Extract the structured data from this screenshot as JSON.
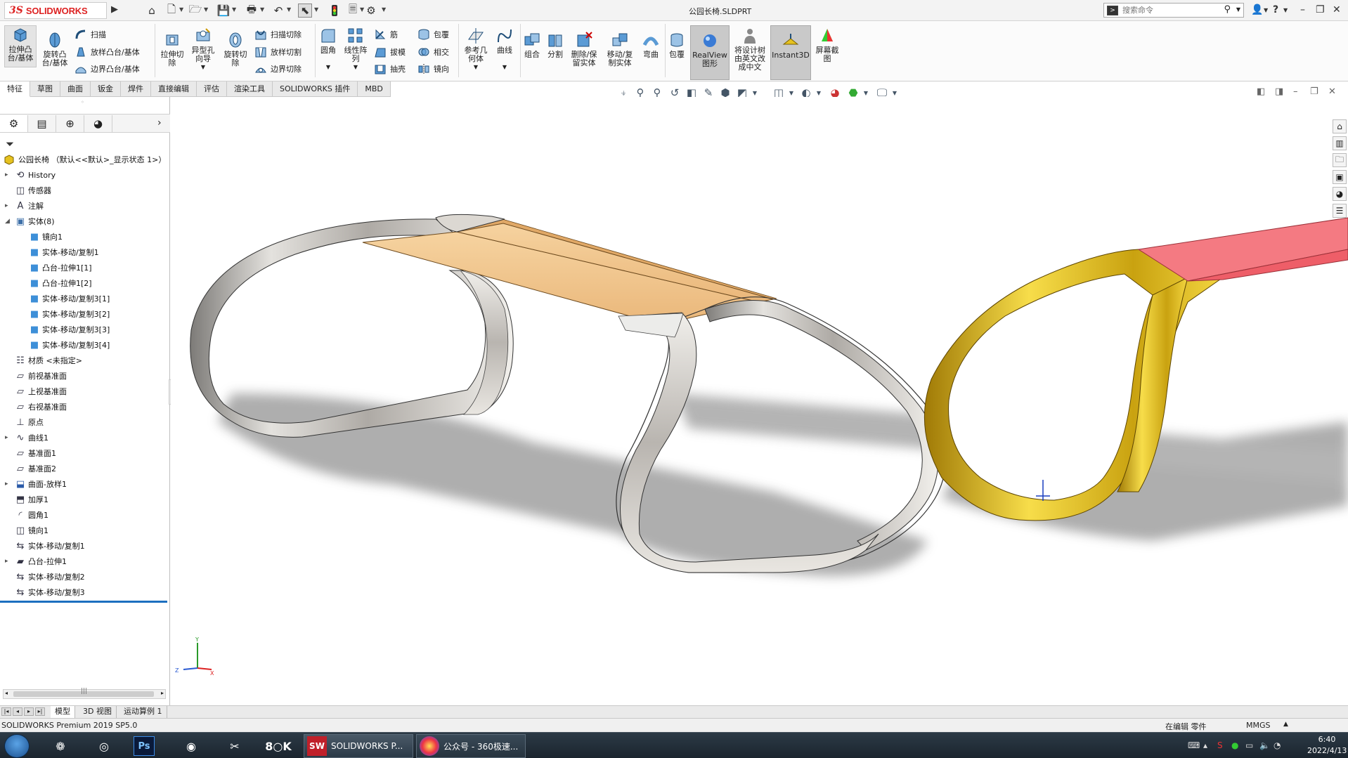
{
  "titlebar": {
    "brand_prefix": "3S",
    "brand": "SOLIDWORKS",
    "document_title": "公园长椅.SLDPRT",
    "search_placeholder": "搜索命令",
    "quick_access_icons": [
      "home-icon",
      "new-file-icon",
      "open-icon",
      "save-icon",
      "print-icon",
      "undo-icon",
      "select-icon",
      "rebuild-icon",
      "file-properties-icon",
      "options-icon"
    ]
  },
  "ribbon": {
    "extrude_boss": "拉伸凸台/基体",
    "revolve_boss": "旋转凸台/基体",
    "sweep": "扫描",
    "loft_boss": "放样凸台/基体",
    "boundary_boss": "边界凸台/基体",
    "extrude_cut": "拉伸切除",
    "hole_wizard": "异型孔向导",
    "revolve_cut": "旋转切除",
    "sweep_cut": "扫描切除",
    "loft_cut": "放样切割",
    "boundary_cut": "边界切除",
    "fillet": "圆角",
    "linear_pattern": "线性阵列",
    "rib": "筋",
    "draft": "拔模",
    "shell": "抽壳",
    "wrap": "包覆",
    "intersect": "相交",
    "mirror": "镜向",
    "ref_geometry": "参考几何体",
    "curves": "曲线",
    "combine": "组合",
    "split": "分割",
    "delete_keep_body": "删除/保留实体",
    "move_copy_body": "移动/复制实体",
    "flex": "弯曲",
    "wrap2": "包覆",
    "realview": "RealView图形",
    "translate_tree": "将设计树由英文改成中文",
    "instant3d": "Instant3D",
    "screen_capture": "屏幕截图"
  },
  "command_tabs": [
    "特征",
    "草图",
    "曲面",
    "钣金",
    "焊件",
    "直接编辑",
    "评估",
    "渲染工具",
    "SOLIDWORKS 插件",
    "MBD"
  ],
  "tree": {
    "root": "公园长椅 （默认<<默认>_显示状态 1>）",
    "items": [
      {
        "label": "History",
        "icon": "history-icon",
        "indent": 0,
        "expandable": true
      },
      {
        "label": "传感器",
        "icon": "sensor-icon",
        "indent": 0,
        "expandable": false
      },
      {
        "label": "注解",
        "icon": "annotation-icon",
        "indent": 0,
        "expandable": true
      },
      {
        "label": "实体(8)",
        "icon": "solid-bodies-icon",
        "indent": 0,
        "expandable": true,
        "expanded": true
      },
      {
        "label": "镜向1",
        "icon": "body-icon",
        "indent": 1
      },
      {
        "label": "实体-移动/复制1",
        "icon": "body-icon",
        "indent": 1
      },
      {
        "label": "凸台-拉伸1[1]",
        "icon": "body-icon",
        "indent": 1
      },
      {
        "label": "凸台-拉伸1[2]",
        "icon": "body-icon",
        "indent": 1
      },
      {
        "label": "实体-移动/复制3[1]",
        "icon": "body-icon",
        "indent": 1
      },
      {
        "label": "实体-移动/复制3[2]",
        "icon": "body-icon",
        "indent": 1
      },
      {
        "label": "实体-移动/复制3[3]",
        "icon": "body-icon",
        "indent": 1
      },
      {
        "label": "实体-移动/复制3[4]",
        "icon": "body-icon",
        "indent": 1
      },
      {
        "label": "材质 <未指定>",
        "icon": "material-icon",
        "indent": 0
      },
      {
        "label": "前视基准面",
        "icon": "plane-icon",
        "indent": 0
      },
      {
        "label": "上视基准面",
        "icon": "plane-icon",
        "indent": 0
      },
      {
        "label": "右视基准面",
        "icon": "plane-icon",
        "indent": 0
      },
      {
        "label": "原点",
        "icon": "origin-icon",
        "indent": 0
      },
      {
        "label": "曲线1",
        "icon": "curve-icon",
        "indent": 0,
        "expandable": true
      },
      {
        "label": "基准面1",
        "icon": "plane-icon",
        "indent": 0
      },
      {
        "label": "基准面2",
        "icon": "plane-icon",
        "indent": 0
      },
      {
        "label": "曲面-放样1",
        "icon": "surface-loft-icon",
        "indent": 0,
        "expandable": true
      },
      {
        "label": "加厚1",
        "icon": "thicken-icon",
        "indent": 0
      },
      {
        "label": "圆角1",
        "icon": "fillet-icon",
        "indent": 0
      },
      {
        "label": "镜向1",
        "icon": "mirror-icon",
        "indent": 0
      },
      {
        "label": "实体-移动/复制1",
        "icon": "move-copy-icon",
        "indent": 0
      },
      {
        "label": "凸台-拉伸1",
        "icon": "extrude-icon",
        "indent": 0,
        "expandable": true
      },
      {
        "label": "实体-移动/复制2",
        "icon": "move-copy-icon",
        "indent": 0
      },
      {
        "label": "实体-移动/复制3",
        "icon": "move-copy-icon",
        "indent": 0
      }
    ]
  },
  "bottom_tabs": [
    "模型",
    "3D 视图",
    "运动算例 1"
  ],
  "status": {
    "product": "SOLIDWORKS Premium 2019 SP5.0",
    "editing": "在编辑 零件",
    "units": "MMGS"
  },
  "taskbar": {
    "tasks": [
      {
        "label": "SOLIDWORKS P...",
        "badge": "SW 2019",
        "icon": "solidworks-icon"
      },
      {
        "label": "公众号 - 360极速...",
        "icon": "browser-360-icon"
      }
    ],
    "clock_time": "6:40",
    "clock_date": "2022/4/13"
  },
  "colors": {
    "brand_red": "#d22222",
    "selection_blue": "#1d6fbf",
    "wood": "#f2c58a",
    "chrome": "#c8c5c0",
    "gold": "#e6c21f",
    "pink": "#f0707a"
  }
}
